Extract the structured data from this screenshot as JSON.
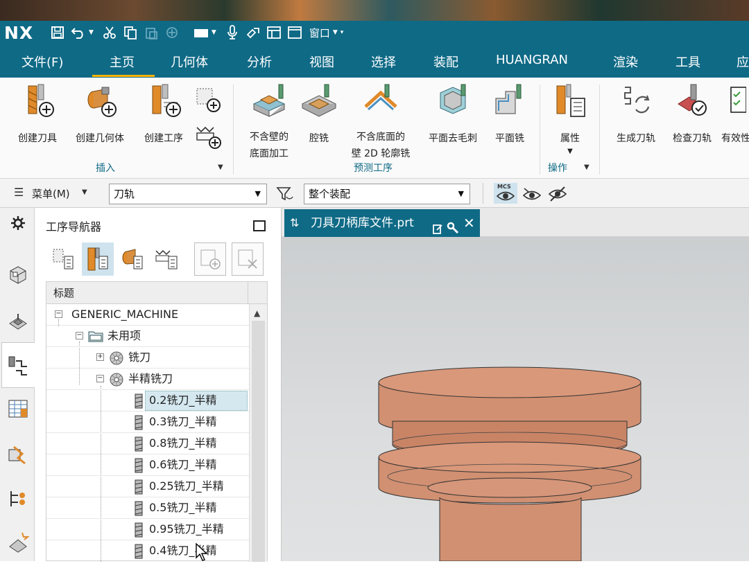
{
  "app": {
    "logo": "NX",
    "quick_access": {
      "icons": [
        "save-icon",
        "undo-icon",
        "cut-icon",
        "copy-icon",
        "paste-icon",
        "move-icon",
        "display-icon",
        "mic-icon",
        "link-icon",
        "layout-icon",
        "window-icon"
      ],
      "window_label": "窗口"
    }
  },
  "menu": {
    "items": [
      "文件(F)",
      "主页",
      "几何体",
      "分析",
      "视图",
      "选择",
      "装配",
      "HUANGRAN",
      "渲染",
      "工具",
      "应"
    ],
    "active": "主页"
  },
  "ribbon": {
    "insert_group": {
      "label": "插入",
      "buttons": [
        "创建刀具",
        "创建几何体",
        "创建工序"
      ]
    },
    "predict_group": {
      "label": "预测工序",
      "buttons": [
        {
          "line1": "不含壁的",
          "line2": "底面加工"
        },
        {
          "line1": "腔铣",
          "line2": ""
        },
        {
          "line1": "不含底面的",
          "line2": "壁 2D 轮廓铣"
        },
        {
          "line1": "平面去毛刺",
          "line2": ""
        },
        {
          "line1": "平面铣",
          "line2": ""
        }
      ]
    },
    "ops_group": {
      "label": "操作",
      "buttons": [
        "属性"
      ]
    },
    "right_buttons": [
      "生成刀轨",
      "检查刀轨",
      "有效性"
    ]
  },
  "toolbar2": {
    "menu_label": "菜单(M)",
    "combo1_value": "刀轨",
    "combo2_value": "整个装配",
    "mcs_label": "MCS"
  },
  "navigator": {
    "title": "工序导航器",
    "column_header": "标题",
    "tree": [
      {
        "label": "GENERIC_MACHINE",
        "level": 0,
        "expander": "−"
      },
      {
        "label": "未用项",
        "level": 1,
        "expander": "−"
      },
      {
        "label": "铣刀",
        "level": 2,
        "expander": "+"
      },
      {
        "label": "半精铣刀",
        "level": 2,
        "expander": "−"
      },
      {
        "label": "0.2铣刀_半精",
        "level": 3,
        "selected": true
      },
      {
        "label": "0.3铣刀_半精",
        "level": 3
      },
      {
        "label": "0.8铣刀_半精",
        "level": 3
      },
      {
        "label": "0.6铣刀_半精",
        "level": 3
      },
      {
        "label": "0.25铣刀_半精",
        "level": 3
      },
      {
        "label": "0.5铣刀_半精",
        "level": 3
      },
      {
        "label": "0.95铣刀_半精",
        "level": 3
      },
      {
        "label": "0.4铣刀_半精",
        "level": 3
      }
    ]
  },
  "viewport": {
    "tab_label": "刀具刀柄库文件.prt",
    "part_color": "#d4906c",
    "background": "#d4d6d7"
  }
}
